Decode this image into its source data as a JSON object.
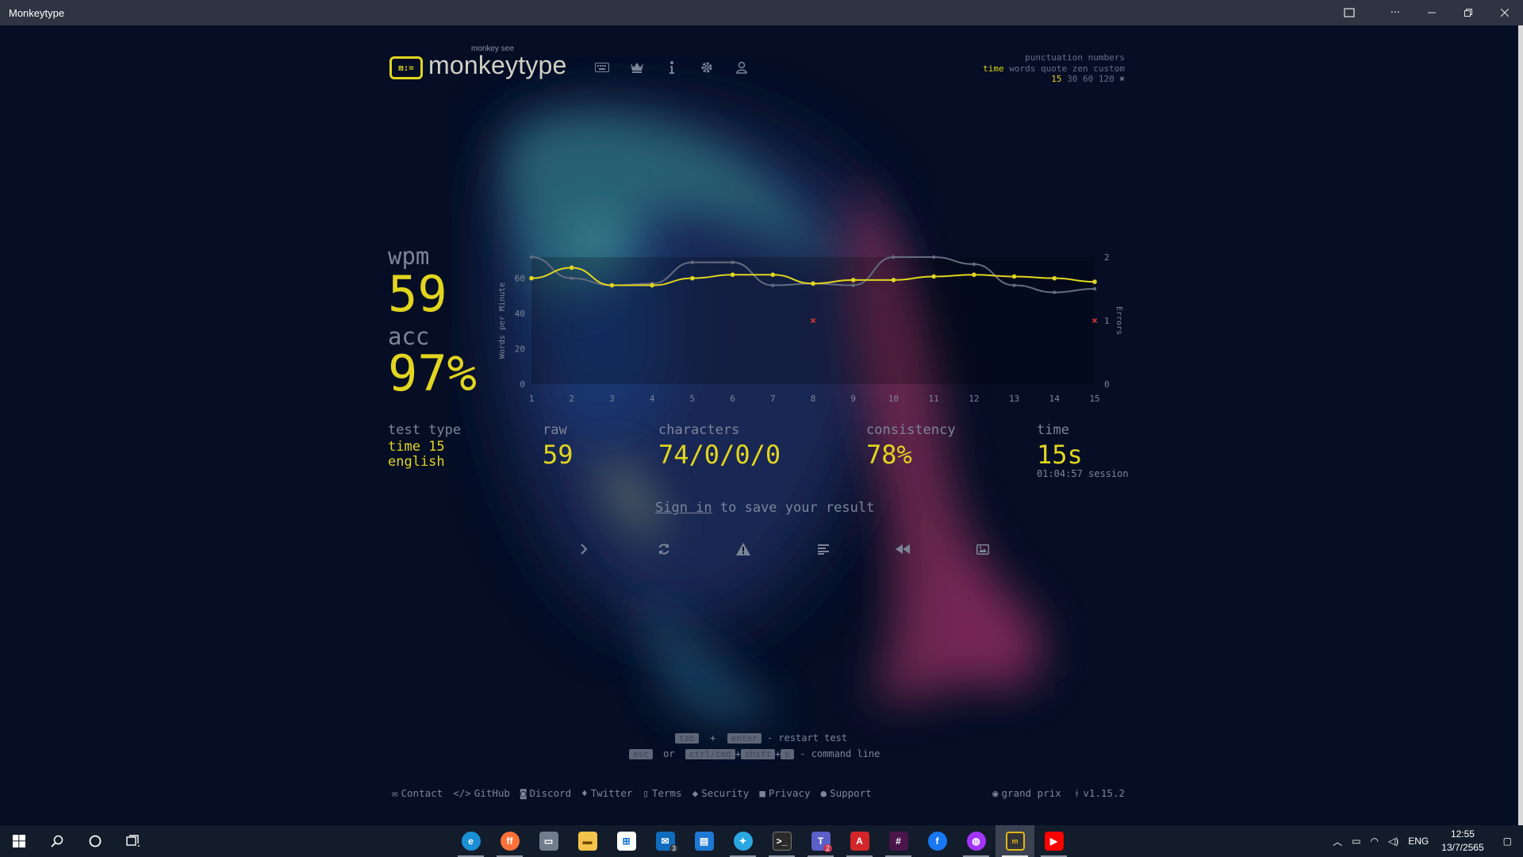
{
  "window": {
    "title": "Monkeytype"
  },
  "header": {
    "logo_sub": "monkey see",
    "logo_text": "monkeytype",
    "nav": [
      "keyboard-icon",
      "crown-icon",
      "info-icon",
      "gear-icon",
      "user-icon"
    ]
  },
  "modes": {
    "row1": "punctuation numbers",
    "row2_active": "time",
    "row2_rest": " words quote zen custom",
    "row3_active": "15",
    "row3_rest": " 30 60 120 "
  },
  "result": {
    "wpm_label": "wpm",
    "wpm": "59",
    "acc_label": "acc",
    "acc": "97%",
    "test_type_label": "test type",
    "test_type_line1": "time 15",
    "test_type_line2": "english",
    "raw_label": "raw",
    "raw": "59",
    "characters_label": "characters",
    "characters": "74/0/0/0",
    "consistency_label": "consistency",
    "consistency": "78%",
    "time_label": "time",
    "time": "15s",
    "session": "01:04:57 session"
  },
  "chart_data": {
    "type": "line",
    "x": [
      1,
      2,
      3,
      4,
      5,
      6,
      7,
      8,
      9,
      10,
      11,
      12,
      13,
      14,
      15
    ],
    "series": [
      {
        "name": "wpm",
        "color": "#e2d51f",
        "values": [
          60,
          66,
          56,
          56,
          60,
          62,
          62,
          57,
          59,
          59,
          61,
          62,
          61,
          60,
          58
        ]
      },
      {
        "name": "raw",
        "color": "#646c7f",
        "values": [
          72,
          60,
          56,
          57,
          69,
          69,
          56,
          57,
          56,
          72,
          72,
          68,
          56,
          52,
          54
        ]
      }
    ],
    "errors": [
      {
        "x": 8,
        "y": 1
      },
      {
        "x": 15,
        "y": 1
      }
    ],
    "ylabel": "Words per Minute",
    "y2label": "Errors",
    "yticks": [
      0,
      20,
      40,
      60
    ],
    "y2ticks": [
      0,
      1,
      2
    ],
    "ylim": [
      0,
      72
    ],
    "y2lim": [
      0,
      2
    ]
  },
  "signin": {
    "link": "Sign in",
    "rest": " to save your result"
  },
  "actions": [
    "next-icon",
    "restart-icon",
    "warning-icon",
    "text-lines-icon",
    "rewind-icon",
    "image-icon"
  ],
  "hints": {
    "k1": "tab",
    "plus1": "+",
    "k2": "enter",
    "r1": " - restart test",
    "k3": "esc",
    "or": "or",
    "k4": "ctrl/cmd",
    "plus2": "+",
    "k5": "shift",
    "plus3": "+",
    "k6": "p",
    "r2": " - command line"
  },
  "footer": {
    "contact": "Contact",
    "github": "GitHub",
    "discord": "Discord",
    "twitter": "Twitter",
    "terms": "Terms",
    "security": "Security",
    "privacy": "Privacy",
    "support": "Support",
    "theme": "grand prix",
    "version": "v1.15.2"
  },
  "taskbar": {
    "lang": "ENG",
    "time": "12:55",
    "date": "13/7/2565",
    "mail_badge": "3",
    "teams_badge": "2"
  }
}
